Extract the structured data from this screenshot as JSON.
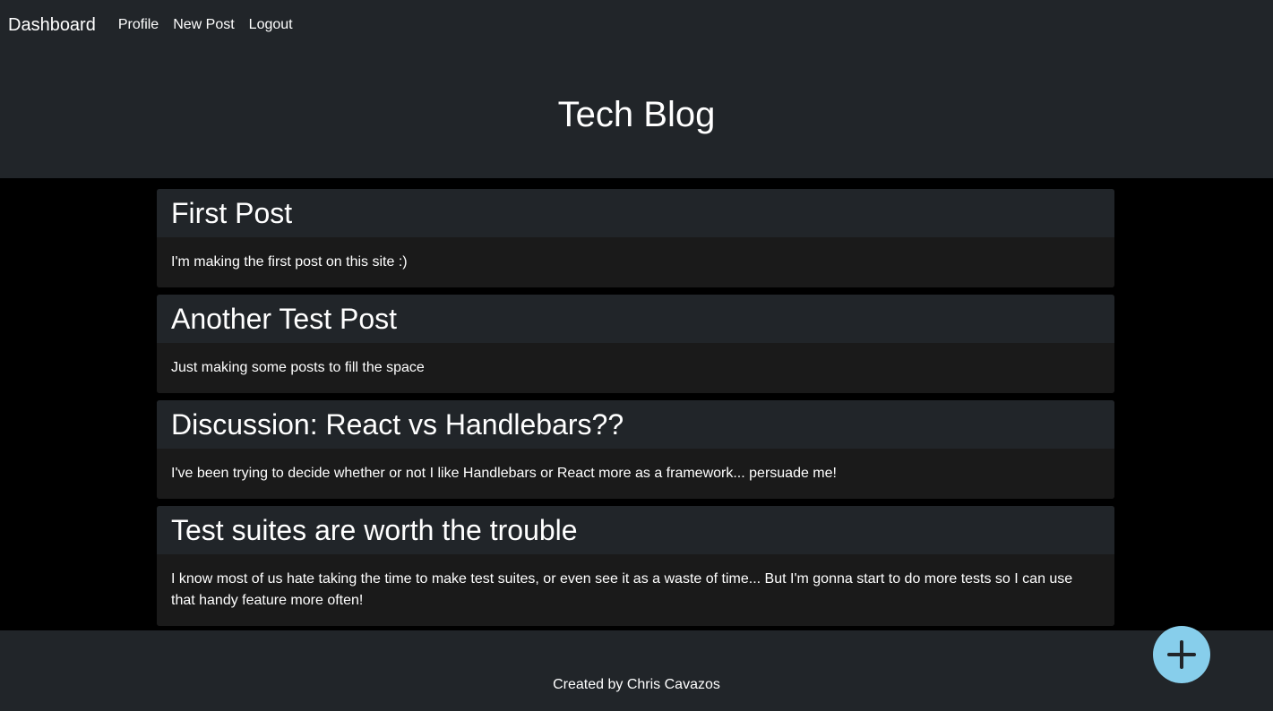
{
  "nav": {
    "brand": "Dashboard",
    "links": [
      "Profile",
      "New Post",
      "Logout"
    ]
  },
  "header": {
    "title": "Tech Blog"
  },
  "posts": [
    {
      "title": "First Post",
      "body": "I'm making the first post on this site :)"
    },
    {
      "title": "Another Test Post",
      "body": "Just making some posts to fill the space"
    },
    {
      "title": "Discussion: React vs Handlebars??",
      "body": "I've been trying to decide whether or not I like Handlebars or React more as a framework... persuade me!"
    },
    {
      "title": "Test suites are worth the trouble",
      "body": "I know most of us hate taking the time to make test suites, or even see it as a waste of time... But I'm gonna start to do more tests so I can use that handy feature more often!"
    }
  ],
  "footer": {
    "credit": "Created by Chris Cavazos"
  },
  "fab": {
    "icon": "plus-icon"
  },
  "colors": {
    "background": "#000000",
    "panel": "#212529",
    "card_body": "#1a1a1a",
    "fab": "#87ceeb"
  }
}
